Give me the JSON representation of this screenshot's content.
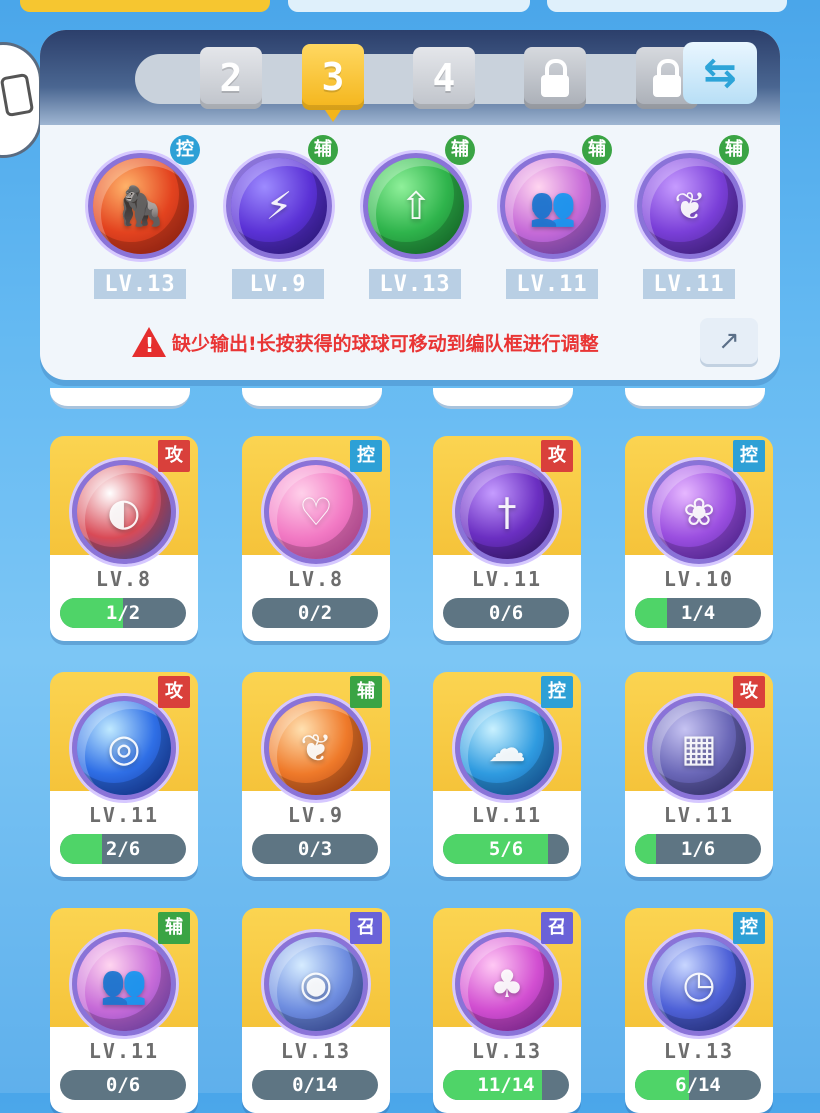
{
  "colors": {
    "attack": "#d9403b",
    "control": "#2da0d6",
    "support": "#3aa444",
    "summon": "#6a62d8",
    "progress_fill": "#4fd468",
    "progress_bg": "#5e7583",
    "warning": "#e93535"
  },
  "tiers": [
    {
      "label": "2",
      "state": "normal"
    },
    {
      "label": "3",
      "state": "active"
    },
    {
      "label": "4",
      "state": "normal"
    },
    {
      "label": "",
      "state": "locked"
    },
    {
      "label": "",
      "state": "locked"
    }
  ],
  "swap_icon": "⇆",
  "share_icon": "↗",
  "team": [
    {
      "name": "ape-orb-icon",
      "role": "控",
      "role_color": "#2da0d6",
      "level": "LV.13",
      "symbol": "🦍",
      "orb": [
        "#ffb36a",
        "#e3431f",
        "#9c1f12"
      ]
    },
    {
      "name": "lightning-orb-icon",
      "role": "辅",
      "role_color": "#3aa444",
      "level": "LV.9",
      "symbol": "⚡",
      "orb": [
        "#9d8bff",
        "#5b32d6",
        "#28167e"
      ]
    },
    {
      "name": "arrow-star-orb-icon",
      "role": "辅",
      "role_color": "#3aa444",
      "level": "LV.13",
      "symbol": "⇧",
      "orb": [
        "#8ff09a",
        "#2fb44c",
        "#116a26"
      ]
    },
    {
      "name": "crowd-orb-icon",
      "role": "辅",
      "role_color": "#3aa444",
      "level": "LV.11",
      "symbol": "👥",
      "orb": [
        "#ffd5f0",
        "#c76bd8",
        "#6b3fb8"
      ]
    },
    {
      "name": "leaf-orb-icon",
      "role": "辅",
      "role_color": "#3aa444",
      "level": "LV.11",
      "symbol": "❦",
      "orb": [
        "#c69bff",
        "#7a3fd8",
        "#3a1a7e"
      ]
    }
  ],
  "warning_text": "缺少输出!长按获得的球球可移动到编队框进行调整",
  "balls": [
    {
      "name": "wave-orb-icon",
      "role": "攻",
      "role_color": "#d9403b",
      "level": "LV.8",
      "progress": "1/2",
      "fraction": 0.5,
      "symbol": "◐",
      "orb": [
        "#ffffff",
        "#d94a56",
        "#2a5cc9"
      ]
    },
    {
      "name": "heart-orb-icon",
      "role": "控",
      "role_color": "#2da0d6",
      "level": "LV.8",
      "progress": "0/2",
      "fraction": 0,
      "symbol": "♡",
      "orb": [
        "#ffd0ea",
        "#f27ac4",
        "#c0419a"
      ]
    },
    {
      "name": "sword-orb-icon",
      "role": "攻",
      "role_color": "#d9403b",
      "level": "LV.11",
      "progress": "0/6",
      "fraction": 0,
      "symbol": "†",
      "orb": [
        "#c59cff",
        "#6b2fc2",
        "#2e1563"
      ]
    },
    {
      "name": "butterfly-orb-icon",
      "role": "控",
      "role_color": "#2da0d6",
      "level": "LV.10",
      "progress": "1/4",
      "fraction": 0.25,
      "symbol": "❀",
      "orb": [
        "#e6b7ff",
        "#9b4fe0",
        "#4d1f9e"
      ]
    },
    {
      "name": "vortex-orb-icon",
      "role": "攻",
      "role_color": "#d9403b",
      "level": "LV.11",
      "progress": "2/6",
      "fraction": 0.333,
      "symbol": "◎",
      "orb": [
        "#bfe9ff",
        "#2f6fe6",
        "#0d2b8e"
      ]
    },
    {
      "name": "wings-orb-icon",
      "role": "辅",
      "role_color": "#3aa444",
      "level": "LV.9",
      "progress": "0/3",
      "fraction": 0,
      "symbol": "❦",
      "orb": [
        "#ffe0b0",
        "#ef7a2a",
        "#a2360d"
      ]
    },
    {
      "name": "cloud-orb-icon",
      "role": "控",
      "role_color": "#2da0d6",
      "level": "LV.11",
      "progress": "5/6",
      "fraction": 0.833,
      "symbol": "☁",
      "orb": [
        "#c9f1ff",
        "#2f9be0",
        "#0f4d9e"
      ]
    },
    {
      "name": "stone-orb-icon",
      "role": "攻",
      "role_color": "#d9403b",
      "level": "LV.11",
      "progress": "1/6",
      "fraction": 0.167,
      "symbol": "▦",
      "orb": [
        "#c6c3f2",
        "#6b68b8",
        "#2e2b6e"
      ]
    },
    {
      "name": "crowd-orb-icon",
      "role": "辅",
      "role_color": "#3aa444",
      "level": "LV.11",
      "progress": "0/6",
      "fraction": 0,
      "symbol": "👥",
      "orb": [
        "#ffd5f0",
        "#c76bd8",
        "#6b3fb8"
      ]
    },
    {
      "name": "whirlwind-orb-icon",
      "role": "召",
      "role_color": "#6a62d8",
      "level": "LV.13",
      "progress": "0/14",
      "fraction": 0,
      "symbol": "◉",
      "orb": [
        "#d6ecff",
        "#6f8ee0",
        "#2d3f9a"
      ]
    },
    {
      "name": "mushroom-cloud-orb-icon",
      "role": "召",
      "role_color": "#6a62d8",
      "level": "LV.13",
      "progress": "11/14",
      "fraction": 0.786,
      "symbol": "♣",
      "orb": [
        "#ffc8f4",
        "#d24fd1",
        "#7c1f9a"
      ]
    },
    {
      "name": "clock-orb-icon",
      "role": "控",
      "role_color": "#2da0d6",
      "level": "LV.13",
      "progress": "6/14",
      "fraction": 0.429,
      "symbol": "◷",
      "orb": [
        "#c8d6ff",
        "#4f62d8",
        "#1f2a7e"
      ]
    }
  ]
}
